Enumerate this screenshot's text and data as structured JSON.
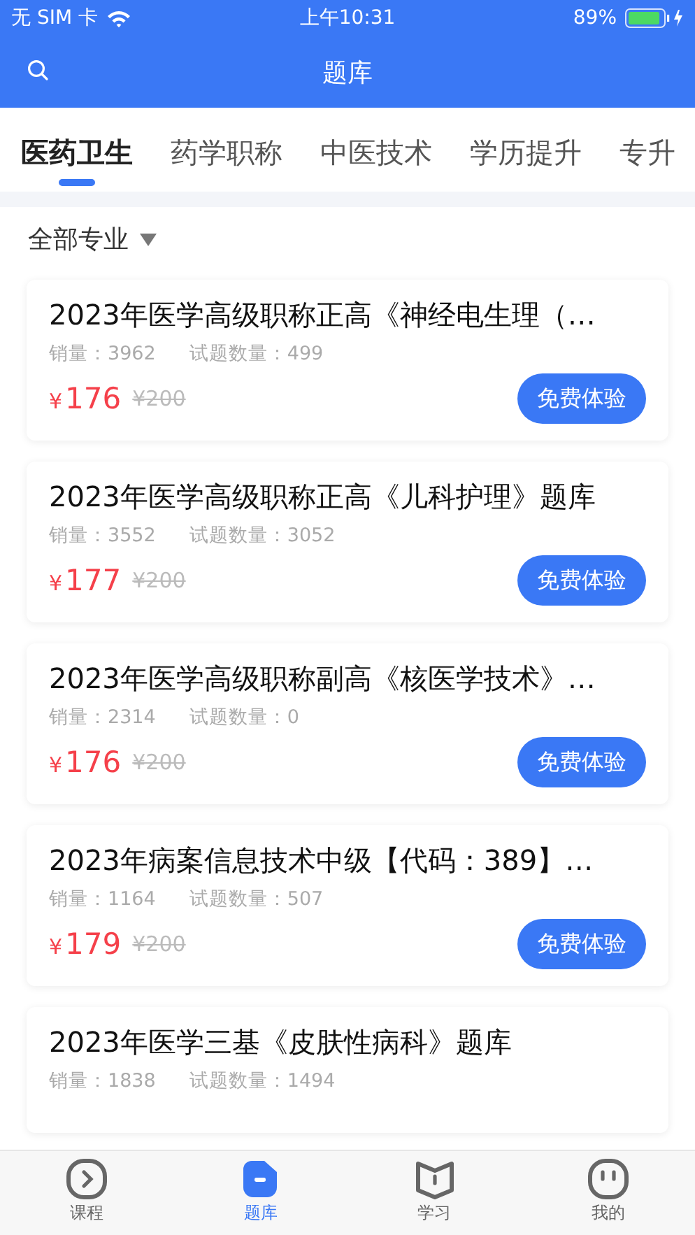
{
  "status_bar": {
    "carrier": "无 SIM 卡",
    "time": "上午10:31",
    "battery": "89%"
  },
  "header": {
    "title": "题库"
  },
  "tabs": [
    {
      "label": "医药卫生",
      "selected": true
    },
    {
      "label": "药学职称",
      "selected": false
    },
    {
      "label": "中医技术",
      "selected": false
    },
    {
      "label": "学历提升",
      "selected": false
    },
    {
      "label": "专升",
      "selected": false
    }
  ],
  "filter": {
    "label": "全部专业"
  },
  "courses": [
    {
      "title": "2023年医学高级职称正高《神经电生理（…",
      "sales_label": "销量：",
      "sales": "3962",
      "count_label": "试题数量：",
      "count": "499",
      "price": "176",
      "currency": "¥",
      "original_price": "¥200",
      "button": "免费体验"
    },
    {
      "title": "2023年医学高级职称正高《儿科护理》题库",
      "sales_label": "销量：",
      "sales": "3552",
      "count_label": "试题数量：",
      "count": "3052",
      "price": "177",
      "currency": "¥",
      "original_price": "¥200",
      "button": "免费体验"
    },
    {
      "title": "2023年医学高级职称副高《核医学技术》…",
      "sales_label": "销量：",
      "sales": "2314",
      "count_label": "试题数量：",
      "count": "0",
      "price": "176",
      "currency": "¥",
      "original_price": "¥200",
      "button": "免费体验"
    },
    {
      "title": "2023年病案信息技术中级【代码：389】…",
      "sales_label": "销量：",
      "sales": "1164",
      "count_label": "试题数量：",
      "count": "507",
      "price": "179",
      "currency": "¥",
      "original_price": "¥200",
      "button": "免费体验"
    },
    {
      "title": "2023年医学三基《皮肤性病科》题库",
      "sales_label": "销量：",
      "sales": "1838",
      "count_label": "试题数量：",
      "count": "1494"
    }
  ],
  "tab_bar": [
    {
      "label": "课程",
      "kind": "play",
      "selected": false
    },
    {
      "label": "题库",
      "kind": "bank",
      "selected": true
    },
    {
      "label": "学习",
      "kind": "book",
      "selected": false
    },
    {
      "label": "我的",
      "kind": "face",
      "selected": false
    }
  ]
}
